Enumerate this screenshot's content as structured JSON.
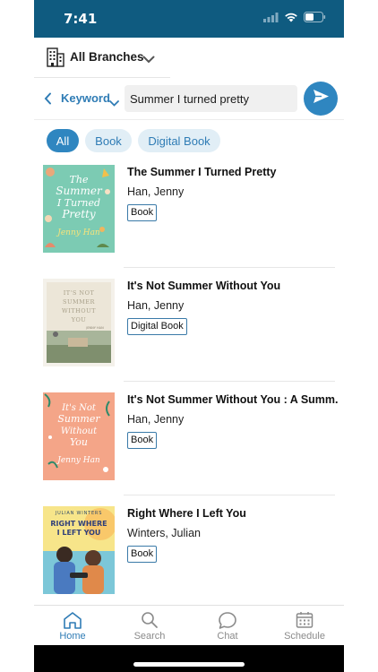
{
  "status": {
    "time": "7:41"
  },
  "branch": {
    "label": "All Branches"
  },
  "search": {
    "mode": "Keyword",
    "query": "Summer I turned pretty"
  },
  "filters": [
    "All",
    "Book",
    "Digital Book"
  ],
  "results": [
    {
      "title": "The Summer I Turned Pretty",
      "author": "Han, Jenny",
      "format": "Book"
    },
    {
      "title": "It's Not Summer Without You",
      "author": "Han, Jenny",
      "format": "Digital Book"
    },
    {
      "title": "It's Not Summer Without You : A Summ...",
      "author": "Han, Jenny",
      "format": "Book"
    },
    {
      "title": "Right Where I Left You",
      "author": "Winters, Julian",
      "format": "Book"
    }
  ],
  "covers": [
    {
      "lines": [
        "The",
        "Summer",
        "I Turned",
        "Pretty"
      ],
      "byline": "Jenny Han"
    },
    {
      "lines": [
        "IT'S NOT",
        "SUMMER",
        "WITHOUT",
        "YOU"
      ],
      "byline": "JENNY HAN"
    },
    {
      "lines": [
        "It's Not",
        "Summer",
        "Without",
        "You"
      ],
      "byline": "Jenny Han"
    },
    {
      "lines": [
        "RIGHT WHERE",
        "I LEFT YOU"
      ],
      "byline": "JULIAN WINTERS"
    }
  ],
  "tabs": [
    {
      "label": "Home",
      "icon": "home-icon"
    },
    {
      "label": "Search",
      "icon": "search-icon"
    },
    {
      "label": "Chat",
      "icon": "chat-icon"
    },
    {
      "label": "Schedule",
      "icon": "calendar-icon"
    }
  ],
  "colors": {
    "brand": "#0f5b80",
    "accent": "#2f86c0",
    "chip_bg": "#e1eef6"
  }
}
